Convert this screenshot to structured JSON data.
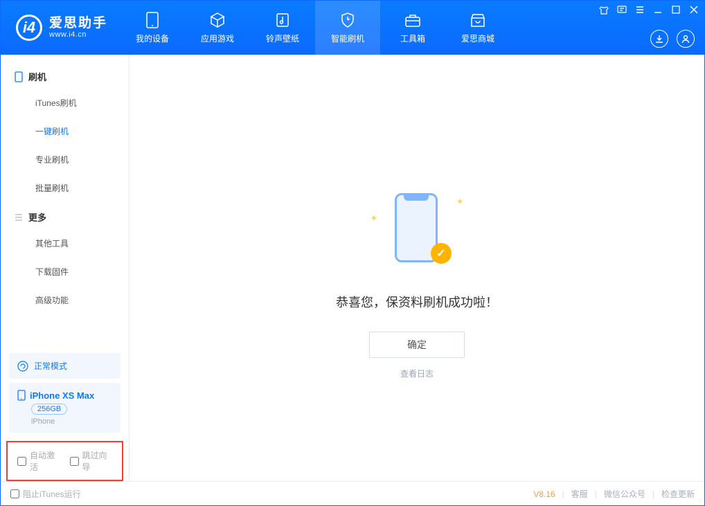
{
  "app": {
    "name": "爱思助手",
    "domain": "www.i4.cn"
  },
  "tabs": [
    {
      "label": "我的设备",
      "icon": "device-icon"
    },
    {
      "label": "应用游戏",
      "icon": "cube-icon"
    },
    {
      "label": "铃声壁纸",
      "icon": "music-icon"
    },
    {
      "label": "智能刷机",
      "icon": "shield-icon"
    },
    {
      "label": "工具箱",
      "icon": "toolbox-icon"
    },
    {
      "label": "爱思商城",
      "icon": "store-icon"
    }
  ],
  "sidebar": {
    "group1_title": "刷机",
    "group1": [
      "iTunes刷机",
      "一键刷机",
      "专业刷机",
      "批量刷机"
    ],
    "group2_title": "更多",
    "group2": [
      "其他工具",
      "下载固件",
      "高级功能"
    ]
  },
  "mode_label": "正常模式",
  "device": {
    "name": "iPhone XS Max",
    "capacity": "256GB",
    "type": "iPhone"
  },
  "checkboxes": {
    "auto_activate": "自动激活",
    "skip_guide": "跳过向导"
  },
  "main": {
    "message": "恭喜您，保资料刷机成功啦！",
    "ok": "确定",
    "view_log": "查看日志"
  },
  "statusbar": {
    "block_itunes": "阻止iTunes运行",
    "version": "V8.16",
    "links": [
      "客服",
      "微信公众号",
      "检查更新"
    ]
  }
}
